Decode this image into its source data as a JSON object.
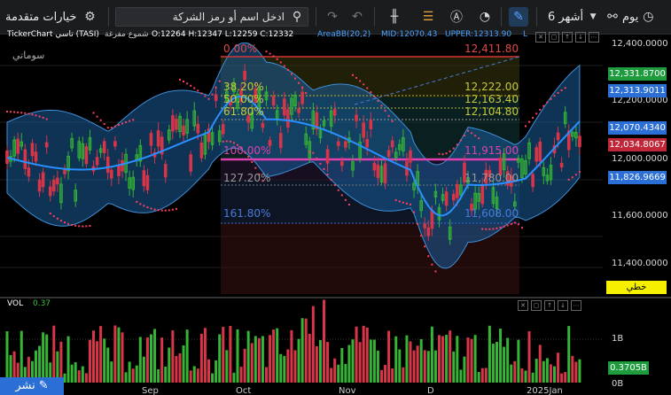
{
  "toolbar": {
    "advanced_label": "خيارات متقدمة",
    "search_placeholder": "ادخل اسم أو رمز الشركة",
    "period_label": "6 أشهر",
    "interval_label": "يوم"
  },
  "info": {
    "ticker": "TickerChart تاسي (TASI)",
    "candle_type": "شموع مفرغة",
    "ohlc": "O:12264  H:12347  L:12259  C:12332",
    "indicator": "AreaBB(20,2)",
    "mid": "MID:12070.43",
    "upper": "UPPER:12313.90",
    "lower": "L",
    "badge": "سوماتي"
  },
  "fib": {
    "top": "0.00%",
    "top_val": "12,411.80",
    "l382": "38.20%",
    "v382": "12,222.00",
    "l50": "50.00%",
    "v50": "12,163.40",
    "l618": "61.80%",
    "v618": "12,104.80",
    "l100": "100.00%",
    "v100": "11,915.00",
    "l1272": "127.20%",
    "v1272": "11,780.00",
    "l1618": "161.80%",
    "v1618": "11,608.00"
  },
  "yaxis": {
    "ticks": [
      "12,400.0000",
      "12,200.0000",
      "12,000.0000",
      "11,800.0000",
      "11,600.0000",
      "11,400.0000"
    ],
    "last": "12,331.8700",
    "upper": "12,313.9011",
    "mid": "12,070.4340",
    "close2": "12,034.8067",
    "lower": "11,826.9669",
    "mode": "خطي"
  },
  "volume": {
    "label": "VOL",
    "value": "0.37",
    "tick": "1B",
    "last": "0.3705B",
    "zero": "0B"
  },
  "xaxis": {
    "labels": [
      "Sep",
      "Oct",
      "Nov",
      "D",
      "2025Jan"
    ]
  },
  "publish_label": "نشر",
  "colors": {
    "up": "#35b435",
    "down": "#d83548",
    "band": "#1f6fb5",
    "mid": "#2a8fff",
    "fib_top": "#d83535",
    "fib_gold": "#c8c83a",
    "fib_pink": "#e040b0",
    "fib_blue": "#3b6bd8",
    "sar": "#ff4060",
    "label_box_blue": "#2b6fd6",
    "label_box_red": "#c0283a",
    "label_box_green": "#1e9b3c",
    "mode_box": "#f5ef00"
  }
}
